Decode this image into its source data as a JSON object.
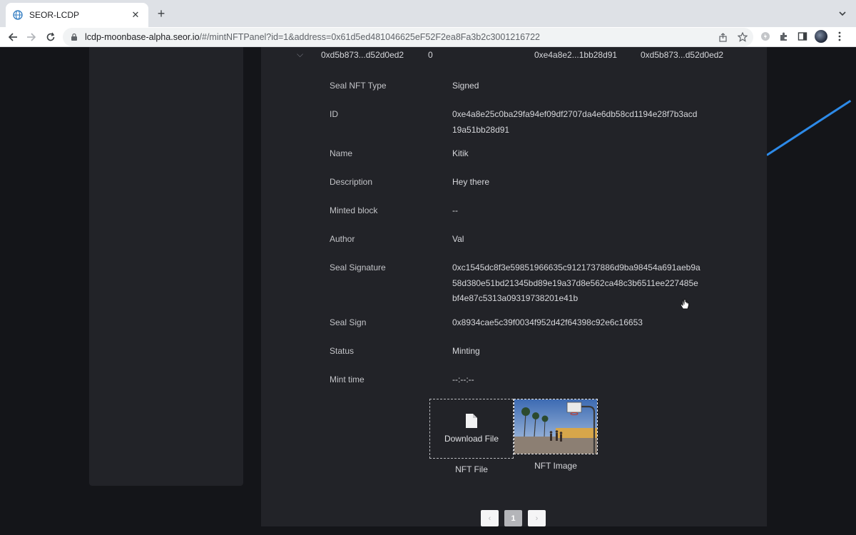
{
  "browser": {
    "tab_title": "SEOR-LCDP",
    "url_host": "lcdp-moonbase-alpha.seor.io",
    "url_path": "/#/mintNFTPanel?id=1&address=0x61d5ed481046625eF52F2ea8Fa3b2c3001216722"
  },
  "summary_row": {
    "col1": "0xd5b873...d52d0ed2",
    "col2": "0",
    "col3": "0xe4a8e2...1bb28d91",
    "col4": "0xd5b873...d52d0ed2"
  },
  "details": [
    {
      "label": "Seal NFT Type",
      "value": "Signed"
    },
    {
      "label": "ID",
      "value": "0xe4a8e25c0ba29fa94ef09df2707da4e6db58cd1194e28f7b3acd19a51bb28d91"
    },
    {
      "label": "Name",
      "value": "Kitik"
    },
    {
      "label": "Description",
      "value": "Hey there"
    },
    {
      "label": "Minted block",
      "value": "--"
    },
    {
      "label": "Author",
      "value": "Val"
    },
    {
      "label": "Seal Signature",
      "value": "0xc1545dc8f3e59851966635c9121737886d9ba98454a691aeb9a58d380e51bd21345bd89e19a37d8e562ca48c3b6511ee227485ebf4e87c5313a09319738201e41b"
    },
    {
      "label": "Seal Sign",
      "value": "0x8934cae5c39f0034f952d42f64398c92e6c16653"
    },
    {
      "label": "Status",
      "value": "Minting"
    },
    {
      "label": "Mint time",
      "value": "--:--:--"
    }
  ],
  "media": {
    "download_label": "Download File",
    "file_caption": "NFT File",
    "image_caption": "NFT Image"
  },
  "pagination": {
    "prev": "‹",
    "current_page": "1",
    "next": "›"
  },
  "icons": {
    "favicon": "globe-icon",
    "file": "file-icon",
    "close": "close-icon",
    "new_tab": "plus-icon"
  },
  "colors": {
    "page_bg": "#141519",
    "card_bg": "#222328",
    "accent_line": "#2d8ae8"
  }
}
